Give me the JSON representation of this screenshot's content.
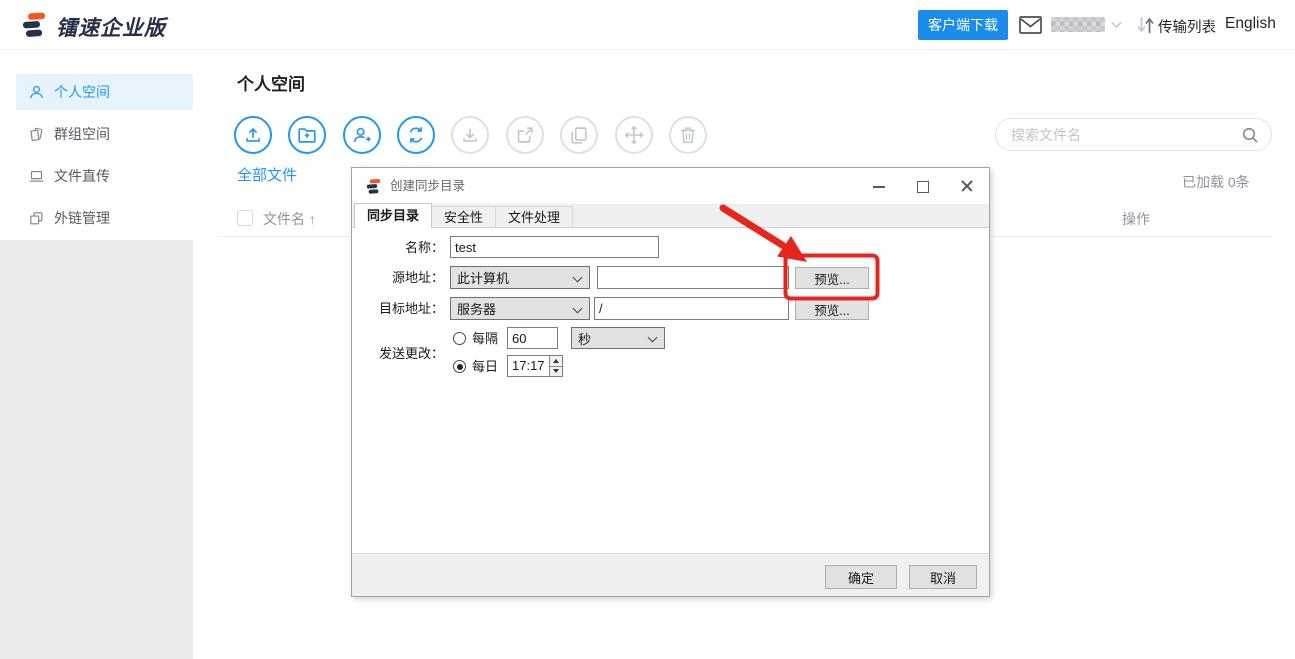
{
  "header": {
    "logo_text": "镭速企业版",
    "download_button": "客户端下载",
    "transfer_label": "传输列表",
    "language": "English"
  },
  "sidebar": {
    "items": [
      {
        "label": "个人空间",
        "active": true
      },
      {
        "label": "群组空间",
        "active": false
      },
      {
        "label": "文件直传",
        "active": false
      },
      {
        "label": "外链管理",
        "active": false
      }
    ]
  },
  "main": {
    "title": "个人空间",
    "all_files_link": "全部文件",
    "loaded_status": "已加载 0条",
    "search_placeholder": "搜索文件名",
    "columns": {
      "name": "文件名 ↑",
      "actions": "操作"
    },
    "toolbar_icons": [
      "upload",
      "new-folder",
      "invite-user",
      "sync",
      "download",
      "external-link",
      "copy",
      "move",
      "delete"
    ]
  },
  "dialog": {
    "title": "创建同步目录",
    "tabs": [
      "同步目录",
      "安全性",
      "文件处理"
    ],
    "fields": {
      "name_label": "名称：",
      "name_value": "test",
      "source_label": "源地址：",
      "source_select": "此计算机",
      "source_path": "",
      "target_label": "目标地址：",
      "target_select": "服务器",
      "target_path": "/",
      "preview_button": "预览...",
      "send_label": "发送更改：",
      "interval_label": "每隔",
      "interval_value": "60",
      "interval_unit": "秒",
      "daily_label": "每日",
      "daily_time": "17:17"
    },
    "ok_button": "确定",
    "cancel_button": "取消"
  },
  "colors": {
    "accent_blue": "#2196f3",
    "download_button_blue": "#1b8ceb",
    "brand_orange": "#f3571f",
    "brand_navy": "#273049",
    "annotation_red": "#e8251d",
    "sidebar_gray": "#ebebeb",
    "dialog_chrome_gray": "#f0f0f0"
  }
}
